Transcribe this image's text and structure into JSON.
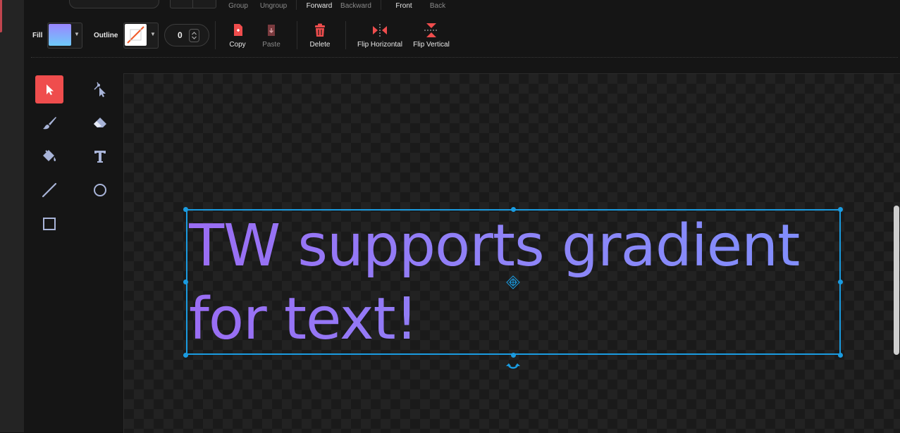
{
  "toolbar_top": {
    "group": "Group",
    "ungroup": "Ungroup",
    "forward": "Forward",
    "backward": "Backward",
    "front": "Front",
    "back": "Back"
  },
  "toolbar": {
    "fill_label": "Fill",
    "outline_label": "Outline",
    "outline_width": "0",
    "copy": "Copy",
    "paste": "Paste",
    "delete": "Delete",
    "flip_horizontal": "Flip Horizontal",
    "flip_vertical": "Flip Vertical"
  },
  "colors": {
    "accent": "#ef4d4d",
    "selection": "#1a9be0",
    "fill_gradient": [
      "#9a86ff",
      "#6fcaf9"
    ],
    "text_gradient": [
      "#9a6df4",
      "#7f8ffd"
    ]
  },
  "tools": [
    {
      "icon": "select-arrow-icon",
      "active": true
    },
    {
      "icon": "reshape-icon",
      "active": false
    },
    {
      "icon": "brush-icon",
      "active": false
    },
    {
      "icon": "eraser-icon",
      "active": false
    },
    {
      "icon": "fill-bucket-icon",
      "active": false
    },
    {
      "icon": "text-tool-icon",
      "active": false
    },
    {
      "icon": "line-icon",
      "active": false
    },
    {
      "icon": "circle-icon",
      "active": false
    },
    {
      "icon": "rectangle-icon",
      "active": false
    }
  ],
  "canvas": {
    "text_line1": "TW supports gradient",
    "text_line2": "for text!"
  }
}
